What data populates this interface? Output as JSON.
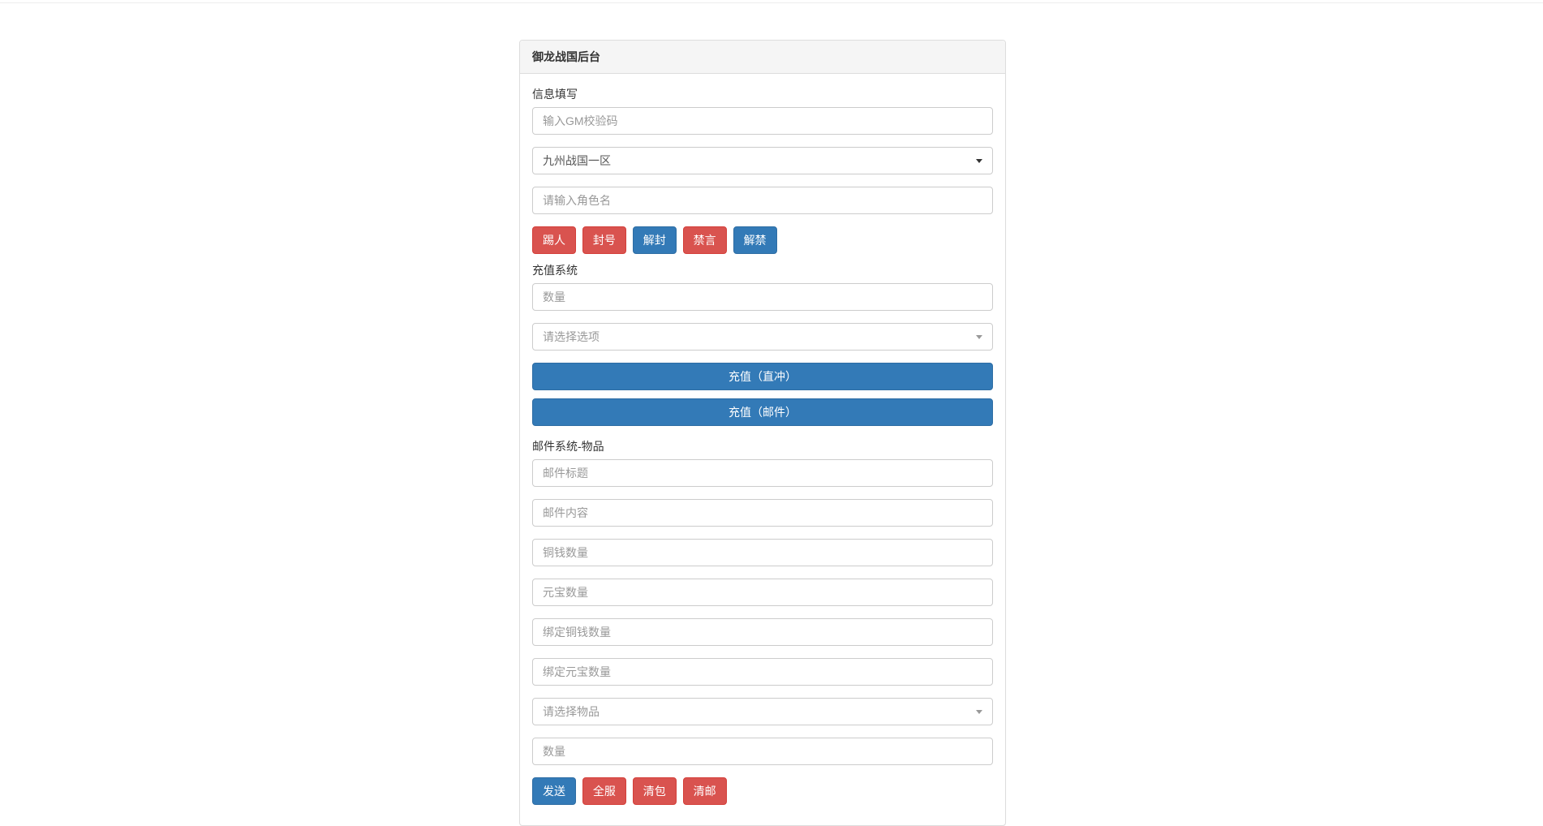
{
  "panel": {
    "title": "御龙战国后台"
  },
  "info": {
    "label": "信息填写",
    "gm_code_placeholder": "输入GM校验码",
    "server_select_value": "九州战国一区",
    "role_name_placeholder": "请输入角色名"
  },
  "info_buttons": {
    "kick": "踢人",
    "ban": "封号",
    "unban": "解封",
    "mute": "禁言",
    "unmute": "解禁"
  },
  "recharge": {
    "label": "充值系统",
    "amount_placeholder": "数量",
    "option_placeholder": "请选择选项",
    "direct_button": "充值（直冲）",
    "mail_button": "充值（邮件）"
  },
  "mail": {
    "label": "邮件系统-物品",
    "title_placeholder": "邮件标题",
    "content_placeholder": "邮件内容",
    "copper_placeholder": "铜钱数量",
    "gold_placeholder": "元宝数量",
    "bind_copper_placeholder": "绑定铜钱数量",
    "bind_gold_placeholder": "绑定元宝数量",
    "item_select_placeholder": "请选择物品",
    "item_qty_placeholder": "数量"
  },
  "mail_buttons": {
    "send": "发送",
    "all_server": "全服",
    "clear_bag": "清包",
    "clear_mail": "清邮"
  }
}
